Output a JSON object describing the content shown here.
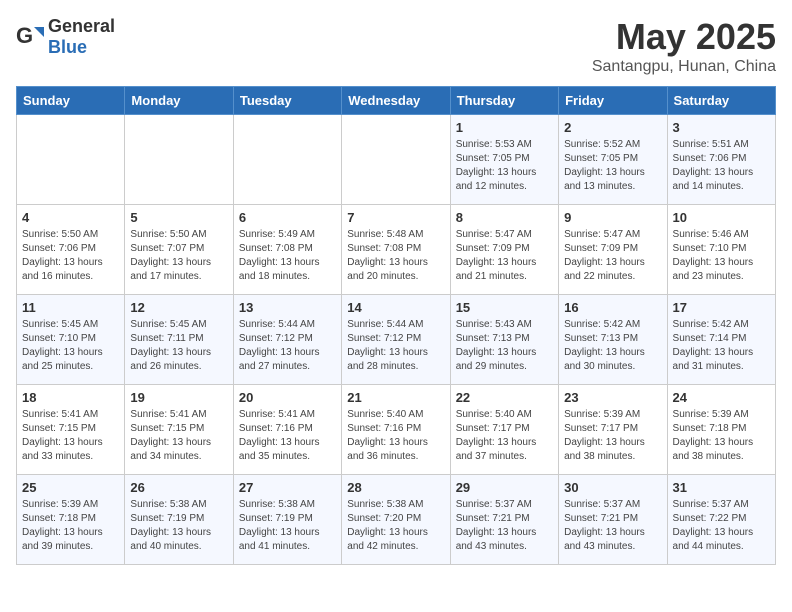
{
  "header": {
    "logo_general": "General",
    "logo_blue": "Blue",
    "title": "May 2025",
    "subtitle": "Santangpu, Hunan, China"
  },
  "days_of_week": [
    "Sunday",
    "Monday",
    "Tuesday",
    "Wednesday",
    "Thursday",
    "Friday",
    "Saturday"
  ],
  "weeks": [
    [
      {
        "day": "",
        "info": ""
      },
      {
        "day": "",
        "info": ""
      },
      {
        "day": "",
        "info": ""
      },
      {
        "day": "",
        "info": ""
      },
      {
        "day": "1",
        "info": "Sunrise: 5:53 AM\nSunset: 7:05 PM\nDaylight: 13 hours\nand 12 minutes."
      },
      {
        "day": "2",
        "info": "Sunrise: 5:52 AM\nSunset: 7:05 PM\nDaylight: 13 hours\nand 13 minutes."
      },
      {
        "day": "3",
        "info": "Sunrise: 5:51 AM\nSunset: 7:06 PM\nDaylight: 13 hours\nand 14 minutes."
      }
    ],
    [
      {
        "day": "4",
        "info": "Sunrise: 5:50 AM\nSunset: 7:06 PM\nDaylight: 13 hours\nand 16 minutes."
      },
      {
        "day": "5",
        "info": "Sunrise: 5:50 AM\nSunset: 7:07 PM\nDaylight: 13 hours\nand 17 minutes."
      },
      {
        "day": "6",
        "info": "Sunrise: 5:49 AM\nSunset: 7:08 PM\nDaylight: 13 hours\nand 18 minutes."
      },
      {
        "day": "7",
        "info": "Sunrise: 5:48 AM\nSunset: 7:08 PM\nDaylight: 13 hours\nand 20 minutes."
      },
      {
        "day": "8",
        "info": "Sunrise: 5:47 AM\nSunset: 7:09 PM\nDaylight: 13 hours\nand 21 minutes."
      },
      {
        "day": "9",
        "info": "Sunrise: 5:47 AM\nSunset: 7:09 PM\nDaylight: 13 hours\nand 22 minutes."
      },
      {
        "day": "10",
        "info": "Sunrise: 5:46 AM\nSunset: 7:10 PM\nDaylight: 13 hours\nand 23 minutes."
      }
    ],
    [
      {
        "day": "11",
        "info": "Sunrise: 5:45 AM\nSunset: 7:10 PM\nDaylight: 13 hours\nand 25 minutes."
      },
      {
        "day": "12",
        "info": "Sunrise: 5:45 AM\nSunset: 7:11 PM\nDaylight: 13 hours\nand 26 minutes."
      },
      {
        "day": "13",
        "info": "Sunrise: 5:44 AM\nSunset: 7:12 PM\nDaylight: 13 hours\nand 27 minutes."
      },
      {
        "day": "14",
        "info": "Sunrise: 5:44 AM\nSunset: 7:12 PM\nDaylight: 13 hours\nand 28 minutes."
      },
      {
        "day": "15",
        "info": "Sunrise: 5:43 AM\nSunset: 7:13 PM\nDaylight: 13 hours\nand 29 minutes."
      },
      {
        "day": "16",
        "info": "Sunrise: 5:42 AM\nSunset: 7:13 PM\nDaylight: 13 hours\nand 30 minutes."
      },
      {
        "day": "17",
        "info": "Sunrise: 5:42 AM\nSunset: 7:14 PM\nDaylight: 13 hours\nand 31 minutes."
      }
    ],
    [
      {
        "day": "18",
        "info": "Sunrise: 5:41 AM\nSunset: 7:15 PM\nDaylight: 13 hours\nand 33 minutes."
      },
      {
        "day": "19",
        "info": "Sunrise: 5:41 AM\nSunset: 7:15 PM\nDaylight: 13 hours\nand 34 minutes."
      },
      {
        "day": "20",
        "info": "Sunrise: 5:41 AM\nSunset: 7:16 PM\nDaylight: 13 hours\nand 35 minutes."
      },
      {
        "day": "21",
        "info": "Sunrise: 5:40 AM\nSunset: 7:16 PM\nDaylight: 13 hours\nand 36 minutes."
      },
      {
        "day": "22",
        "info": "Sunrise: 5:40 AM\nSunset: 7:17 PM\nDaylight: 13 hours\nand 37 minutes."
      },
      {
        "day": "23",
        "info": "Sunrise: 5:39 AM\nSunset: 7:17 PM\nDaylight: 13 hours\nand 38 minutes."
      },
      {
        "day": "24",
        "info": "Sunrise: 5:39 AM\nSunset: 7:18 PM\nDaylight: 13 hours\nand 38 minutes."
      }
    ],
    [
      {
        "day": "25",
        "info": "Sunrise: 5:39 AM\nSunset: 7:18 PM\nDaylight: 13 hours\nand 39 minutes."
      },
      {
        "day": "26",
        "info": "Sunrise: 5:38 AM\nSunset: 7:19 PM\nDaylight: 13 hours\nand 40 minutes."
      },
      {
        "day": "27",
        "info": "Sunrise: 5:38 AM\nSunset: 7:19 PM\nDaylight: 13 hours\nand 41 minutes."
      },
      {
        "day": "28",
        "info": "Sunrise: 5:38 AM\nSunset: 7:20 PM\nDaylight: 13 hours\nand 42 minutes."
      },
      {
        "day": "29",
        "info": "Sunrise: 5:37 AM\nSunset: 7:21 PM\nDaylight: 13 hours\nand 43 minutes."
      },
      {
        "day": "30",
        "info": "Sunrise: 5:37 AM\nSunset: 7:21 PM\nDaylight: 13 hours\nand 43 minutes."
      },
      {
        "day": "31",
        "info": "Sunrise: 5:37 AM\nSunset: 7:22 PM\nDaylight: 13 hours\nand 44 minutes."
      }
    ]
  ]
}
